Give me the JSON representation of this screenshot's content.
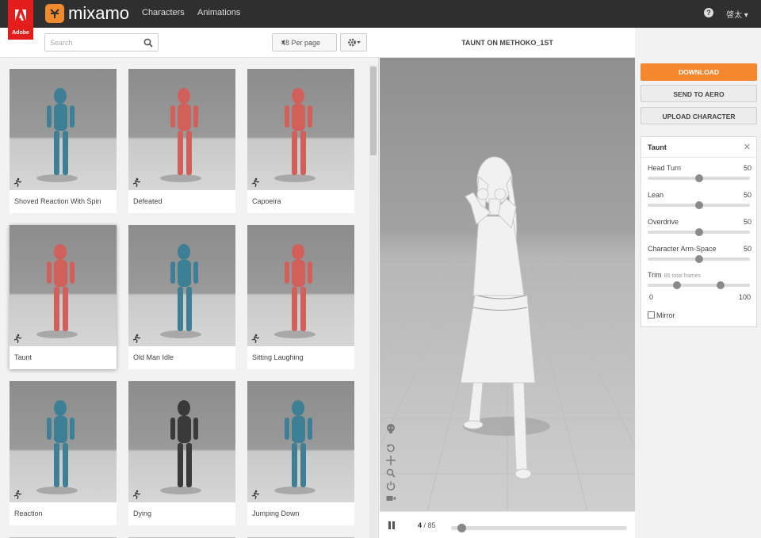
{
  "topbar": {
    "adobe_text": "Adobe",
    "brand": "mixamo",
    "nav": [
      "Characters",
      "Animations"
    ],
    "user": "啓太"
  },
  "browser": {
    "search_placeholder": "Search",
    "per_page": "48 Per page",
    "cards": [
      {
        "label": "Shoved Reaction With Spin",
        "color": "teal"
      },
      {
        "label": "Defeated",
        "color": "red"
      },
      {
        "label": "Capoeira",
        "color": "red"
      },
      {
        "label": "Taunt",
        "color": "red",
        "selected": true
      },
      {
        "label": "Old Man Idle",
        "color": "teal"
      },
      {
        "label": "Sitting Laughing",
        "color": "red"
      },
      {
        "label": "Reaction",
        "color": "teal"
      },
      {
        "label": "Dying",
        "color": "dark"
      },
      {
        "label": "Jumping Down",
        "color": "teal"
      }
    ]
  },
  "viewer": {
    "title": "TAUNT ON METHOKO_1ST",
    "frame_current": "4",
    "frame_total": "/ 85",
    "progress": 0.04
  },
  "actions": {
    "download": "DOWNLOAD",
    "send_to_aero": "SEND TO AERO",
    "upload_character": "UPLOAD CHARACTER"
  },
  "properties": {
    "title": "Taunt",
    "sliders": [
      {
        "label": "Head Turn",
        "value": "50",
        "fraction": 0.5
      },
      {
        "label": "Lean",
        "value": "50",
        "fraction": 0.5
      },
      {
        "label": "Overdrive",
        "value": "50",
        "fraction": 0.5
      },
      {
        "label": "Character Arm-Space",
        "value": "50",
        "fraction": 0.5
      }
    ],
    "trim": {
      "label": "Trim",
      "sub": "86 total frames",
      "min": "0",
      "max": "100",
      "start_fraction": 0.27,
      "end_fraction": 0.73
    },
    "mirror": "Mirror"
  },
  "colors": {
    "accent": "#f5882e",
    "adobe_red": "#e31c1c",
    "teal": "#3d7f95",
    "red": "#d2605a",
    "dark": "#3a3a3a"
  }
}
